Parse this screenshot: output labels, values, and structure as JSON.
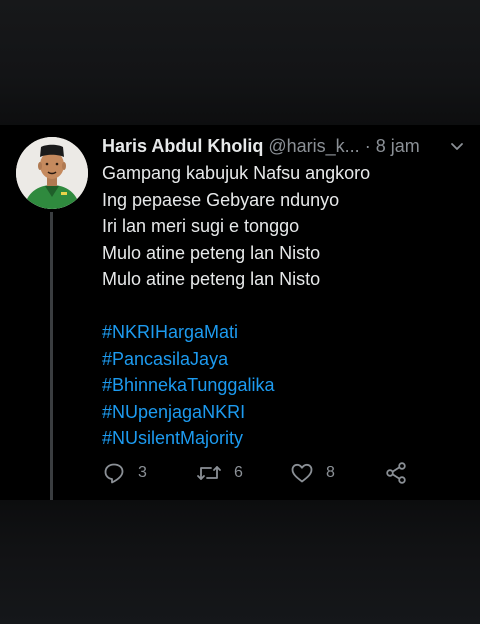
{
  "tweet": {
    "display_name": "Haris Abdul Kholiq",
    "handle": "@haris_k...",
    "separator": "·",
    "time": "8 jam",
    "lines": [
      "Gampang kabujuk Nafsu angkoro",
      "Ing pepaese Gebyare ndunyo",
      "Iri lan meri sugi e tonggo",
      "Mulo atine peteng lan Nisto",
      "Mulo atine peteng lan Nisto"
    ],
    "hashtags": [
      "#NKRIHargaMati",
      "#PancasilaJaya",
      "#BhinnekaTunggalika",
      "#NUpenjagaNKRI",
      "#NUsilentMajority"
    ],
    "actions": {
      "reply_count": "3",
      "retweet_count": "6",
      "like_count": "8"
    }
  },
  "icons": {
    "avatar": "user-avatar",
    "menu": "chevron-down-icon",
    "reply": "reply-icon",
    "retweet": "retweet-icon",
    "like": "heart-icon",
    "share": "share-icon"
  },
  "colors": {
    "background": "#000000",
    "text": "#e7e9ea",
    "muted": "#8b9096",
    "hashtag": "#1d9bf0",
    "thread_line": "#3a3d40"
  }
}
